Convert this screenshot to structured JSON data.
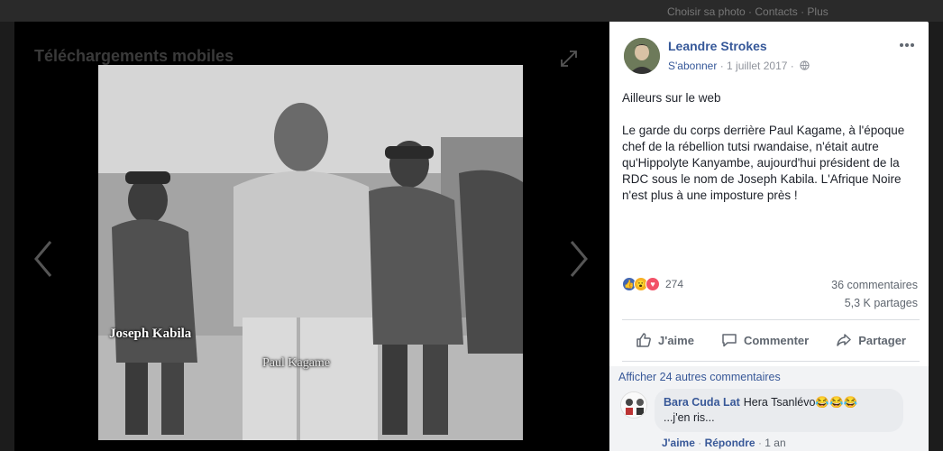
{
  "viewer": {
    "title": "Téléchargements mobiles",
    "caption_left": "Joseph Kabila",
    "caption_center": "Paul Kagame"
  },
  "background_hint": "Choisir sa photo · Contacts · Plus",
  "post": {
    "author": "Leandre Strokes",
    "follow": "S'abonner",
    "dot": "·",
    "date": "1 juillet 2017",
    "paragraph1": "Ailleurs sur le web",
    "paragraph2": "Le garde du corps derrière Paul Kagame, à l'époque chef de la rébellion tutsi rwandaise, n'était autre qu'Hippolyte Kanyambe, aujourd'hui président de la RDC sous le nom de Joseph Kabila. L'Afrique Noire n'est plus à une imposture près !",
    "reaction_count": "274",
    "comments_count": "36 commentaires",
    "shares_count": "5,3 K partages"
  },
  "actions": {
    "like": "J'aime",
    "comment": "Commenter",
    "share": "Partager"
  },
  "comments": {
    "more": "Afficher 24 autres commentaires",
    "items": [
      {
        "author": "Bara Cuda Lat",
        "text": "Hera Tsanlévo😂😂😂",
        "text2": "...j'en ris...",
        "like": "J'aime",
        "reply": "Répondre",
        "sep": "·",
        "time": "1 an"
      }
    ]
  },
  "colors": {
    "link": "#365899",
    "like_reaction": "#4267b2",
    "love_reaction": "#f25268",
    "wow_reaction": "#f7b125"
  }
}
